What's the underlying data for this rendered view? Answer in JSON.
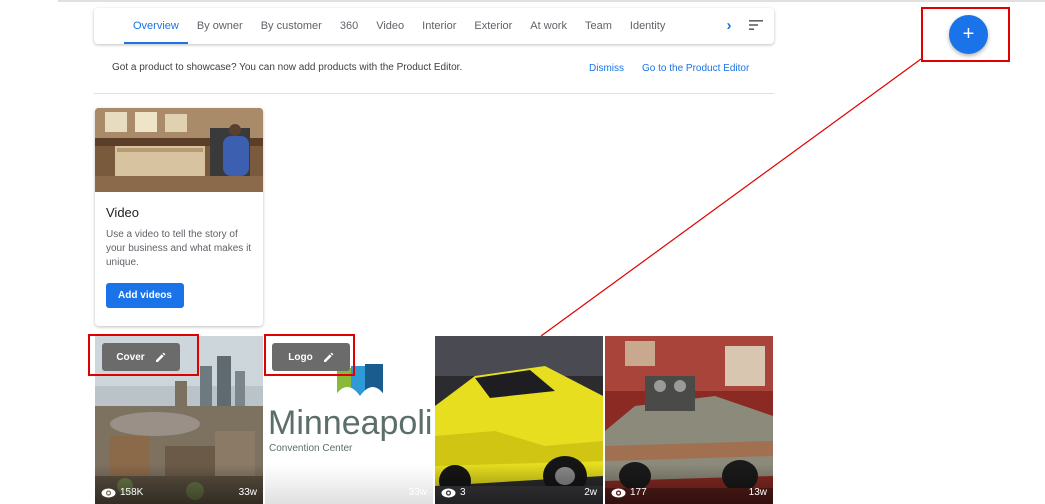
{
  "tabs": [
    {
      "label": "Overview",
      "active": true
    },
    {
      "label": "By owner"
    },
    {
      "label": "By customer"
    },
    {
      "label": "360"
    },
    {
      "label": "Video"
    },
    {
      "label": "Interior"
    },
    {
      "label": "Exterior"
    },
    {
      "label": "At work"
    },
    {
      "label": "Team"
    },
    {
      "label": "Identity"
    }
  ],
  "tabbar": {
    "next_icon": "chevron-right-icon",
    "sort_icon": "sort-icon"
  },
  "banner": {
    "text": "Got a product to showcase? You can now add products with the Product Editor.",
    "dismiss": "Dismiss",
    "editor_link": "Go to the Product Editor"
  },
  "video_card": {
    "title": "Video",
    "description": "Use a video to tell the story of your business and what makes it unique.",
    "button": "Add videos"
  },
  "fab": {
    "label": "+"
  },
  "photos": [
    {
      "chip": "Cover",
      "views": "158K",
      "age": "33w"
    },
    {
      "chip": "Logo",
      "logo_title": "Minneapolis",
      "logo_subtitle": "Convention Center",
      "views": "",
      "age": "33w"
    },
    {
      "views": "3",
      "age": "2w"
    },
    {
      "views": "177",
      "age": "13w"
    }
  ],
  "colors": {
    "accent": "#1a73e8",
    "highlight": "#e00000",
    "chip": "#6b6b6b"
  }
}
